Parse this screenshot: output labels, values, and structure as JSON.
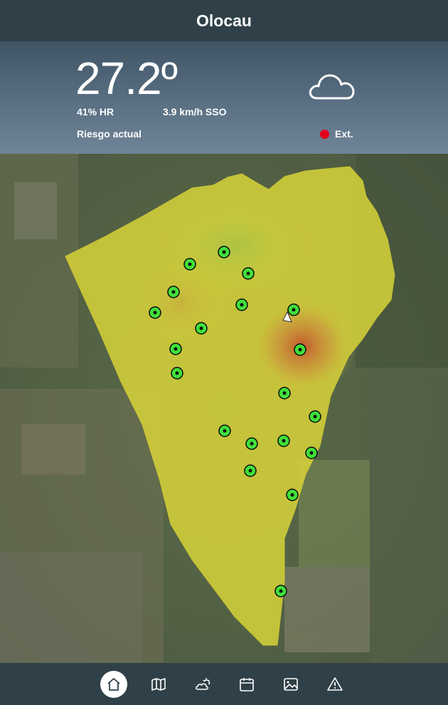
{
  "header": {
    "title": "Olocau"
  },
  "weather": {
    "temperature": "27.2º",
    "humidity": "41% HR",
    "wind": "3.9 km/h SSO",
    "risk_label": "Riesgo actual",
    "risk_value": "Ext.",
    "risk_color": "#e3001b",
    "condition_icon": "cloud-icon"
  },
  "map": {
    "risk_area_color": "#d7d43a",
    "hotspot_color": "#c2462a",
    "station_color": "#3fe13a",
    "station_count": 20,
    "location_marker": "triangle-marker"
  },
  "nav": {
    "items": [
      {
        "icon": "home-icon",
        "active": true
      },
      {
        "icon": "map-icon",
        "active": false
      },
      {
        "icon": "weather-icon",
        "active": false
      },
      {
        "icon": "calendar-icon",
        "active": false
      },
      {
        "icon": "gallery-icon",
        "active": false
      },
      {
        "icon": "alert-icon",
        "active": false
      }
    ]
  }
}
